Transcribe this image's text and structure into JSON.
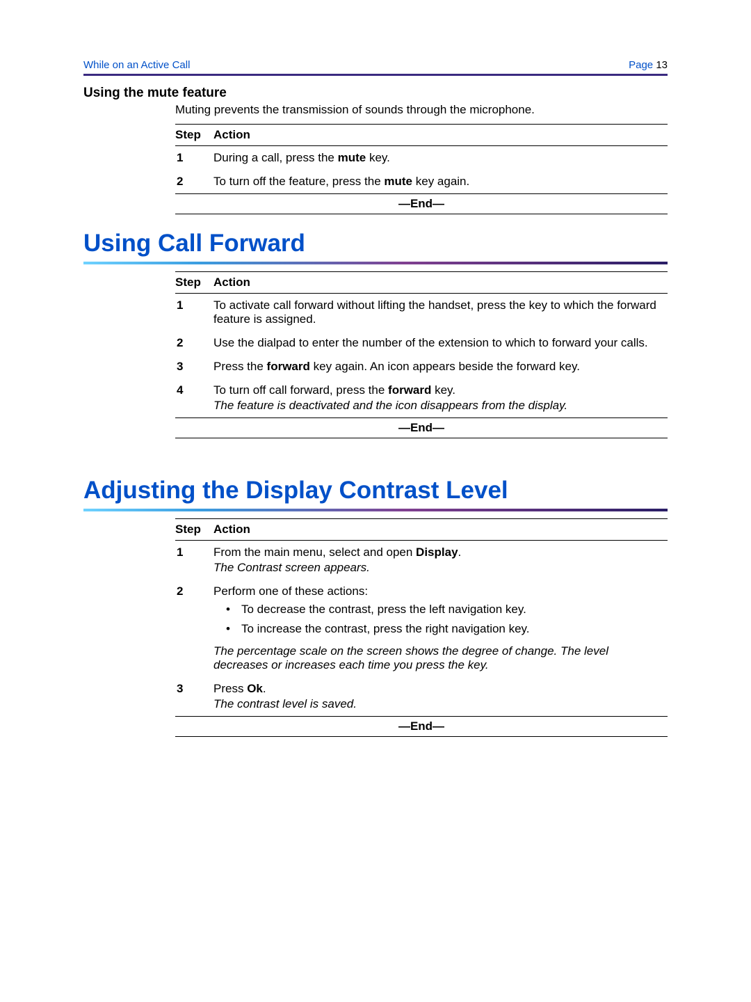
{
  "header": {
    "breadcrumb": "While on an Active Call",
    "page_label": "Page",
    "page_number": "13"
  },
  "section1": {
    "heading": "Using the mute feature",
    "intro": "Muting prevents the transmission of sounds through the microphone.",
    "col_step": "Step",
    "col_action": "Action",
    "step1_num": "1",
    "step1_pre": "During a call, press the ",
    "step1_bold": "mute",
    "step1_post": " key.",
    "step2_num": "2",
    "step2_pre": "To turn off the feature, press the ",
    "step2_bold": "mute",
    "step2_post": " key again.",
    "end": "—End—"
  },
  "section2": {
    "chapter_title": "Using Call Forward",
    "col_step": "Step",
    "col_action": "Action",
    "step1_num": "1",
    "step1_text": "To activate call forward without lifting the handset, press the key to which the forward feature is assigned.",
    "step2_num": "2",
    "step2_text": "Use the dialpad to enter the number of the extension to which to forward your calls.",
    "step3_num": "3",
    "step3_pre": "Press the ",
    "step3_bold": "forward",
    "step3_post": " key again. An icon appears beside the forward key.",
    "step4_num": "4",
    "step4_pre": "To turn off call forward, press the ",
    "step4_bold": "forward",
    "step4_post": " key.",
    "step4_note": "The feature is deactivated and the icon disappears from the display.",
    "end": "—End—"
  },
  "section3": {
    "chapter_title": "Adjusting the Display Contrast Level",
    "col_step": "Step",
    "col_action": "Action",
    "step1_num": "1",
    "step1_pre": "From the main menu, select and open ",
    "step1_bold": "Display",
    "step1_post": ".",
    "step1_note": "The Contrast screen appears.",
    "step2_num": "2",
    "step2_text": "Perform one of these actions:",
    "step2_bullet1": "To decrease the contrast, press the left navigation key.",
    "step2_bullet2": "To increase the contrast, press the right navigation key.",
    "step2_note": "The percentage scale on the screen shows the degree of change. The level decreases or increases each time you press the key.",
    "step3_num": "3",
    "step3_pre": "Press ",
    "step3_bold": "Ok",
    "step3_post": ".",
    "step3_note": "The contrast level is saved.",
    "end": "—End—"
  }
}
